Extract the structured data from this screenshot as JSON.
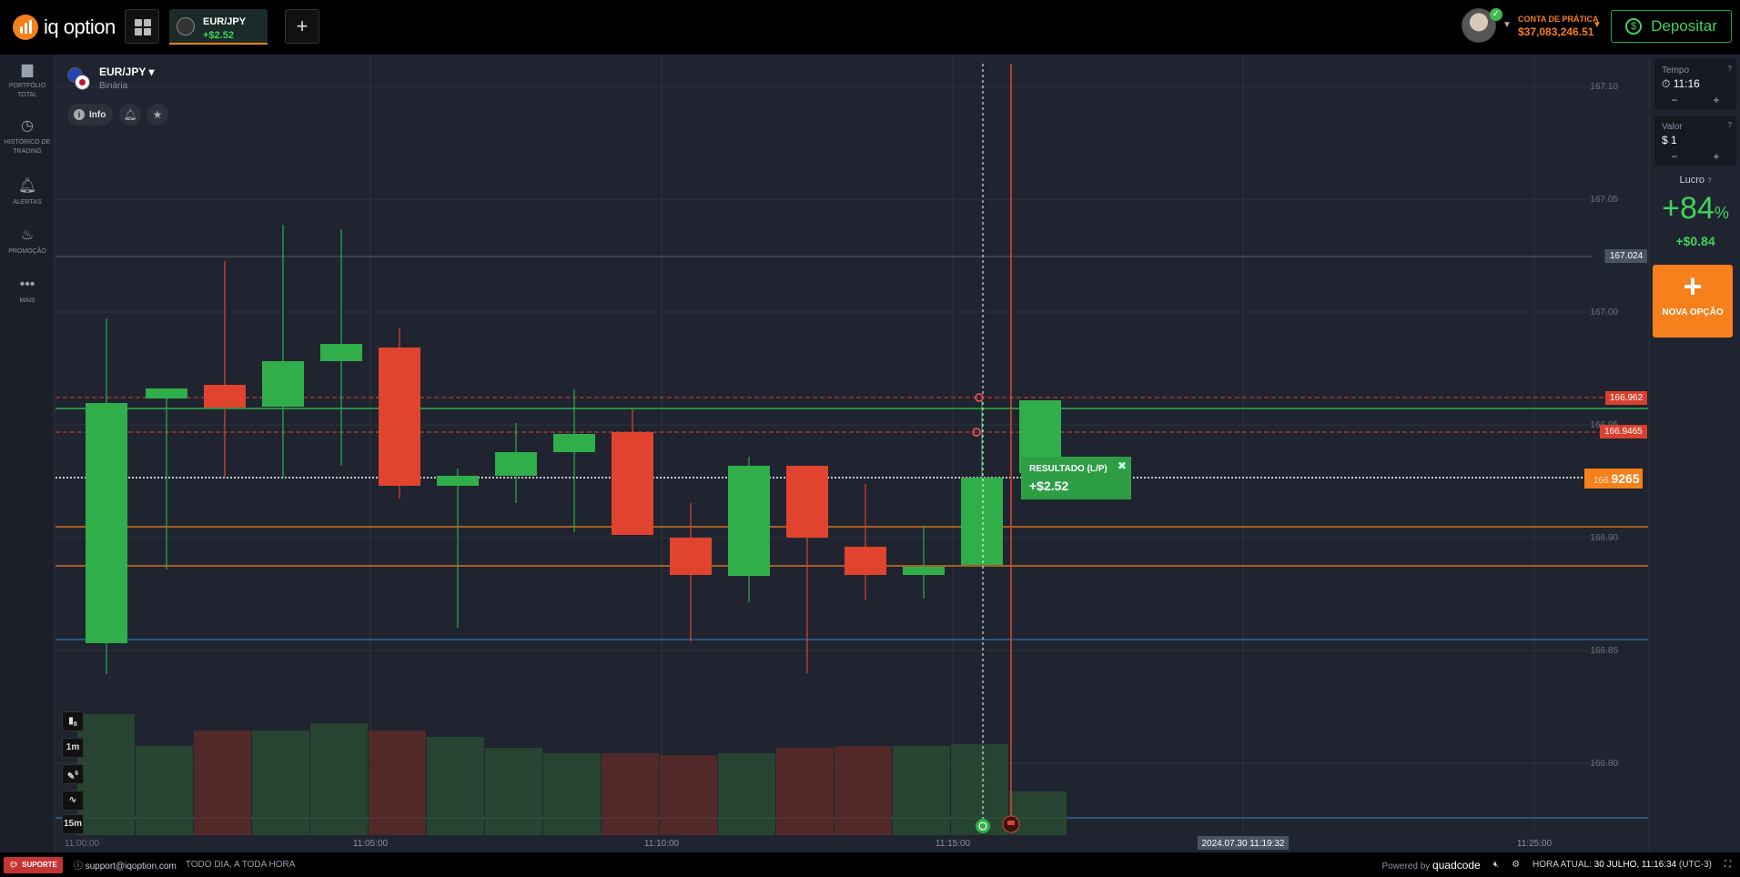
{
  "header": {
    "logo_text": "iq option",
    "asset_tab": {
      "name": "EUR/JPY",
      "pl": "+$2.52"
    },
    "add_tab": "+",
    "account": {
      "label": "CONTA DE PRÁTICA",
      "balance": "$37,083,246.51"
    },
    "deposit_label": "Depositar"
  },
  "sidebar": {
    "items": [
      {
        "label": "PORTFÓLIO TOTAL",
        "icon": "briefcase-icon"
      },
      {
        "label": "HISTÓRICO DE TRADING",
        "icon": "clock-icon"
      },
      {
        "label": "ALERTAS",
        "icon": "bell-icon"
      },
      {
        "label": "PROMOÇÃO",
        "icon": "fire-icon"
      },
      {
        "label": "MAIS",
        "icon": "more-dots-icon"
      }
    ]
  },
  "asset": {
    "pair": "EUR/JPY",
    "type": "Binária",
    "info_label": "Info"
  },
  "chart": {
    "y_ticks": [
      "167.10",
      "167.05",
      "167.00",
      "166.95",
      "166.90",
      "166.85",
      "166.80"
    ],
    "x_ticks": [
      "11:00:00",
      "11:05:00",
      "11:10:00",
      "11:15:00",
      "11:25:00"
    ],
    "time_cursor": "2024.07.30 11:19:32",
    "price_labels": {
      "alert": "167.024",
      "upper_red": "166.962",
      "lower_red": "166.9465",
      "current_prefix": "166.",
      "current_main": "9265"
    },
    "result": {
      "title": "RESULTADO (L/P)",
      "value": "+$2.52"
    },
    "tools": {
      "candles_count": "8",
      "timeframe": "1m",
      "draw_count": "6",
      "period": "15m"
    },
    "colors": {
      "up": "#2fae4a",
      "down": "#e0442e",
      "accent": "#f6801c"
    }
  },
  "trade_panel": {
    "time_label": "Tempo",
    "time_value": "11:16",
    "amount_label": "Valor",
    "amount_value": "$ 1",
    "profit_label": "Lucro",
    "profit_pct": "+84",
    "profit_pct_sign": "%",
    "profit_value": "+$0.84",
    "new_option_label": "NOVA OPÇÃO",
    "minus": "−",
    "plus": "+",
    "help": "?"
  },
  "footer": {
    "support_label": "SUPORTE",
    "email": "support@iqoption.com",
    "hours": "TODO DIA, A TODA HORA",
    "powered_by": "Powered by",
    "brand": "quadcode",
    "clock_label": "HORA ATUAL:",
    "clock_value": "30 JULHO, 11:16:34",
    "tz": "(UTC-3)"
  }
}
